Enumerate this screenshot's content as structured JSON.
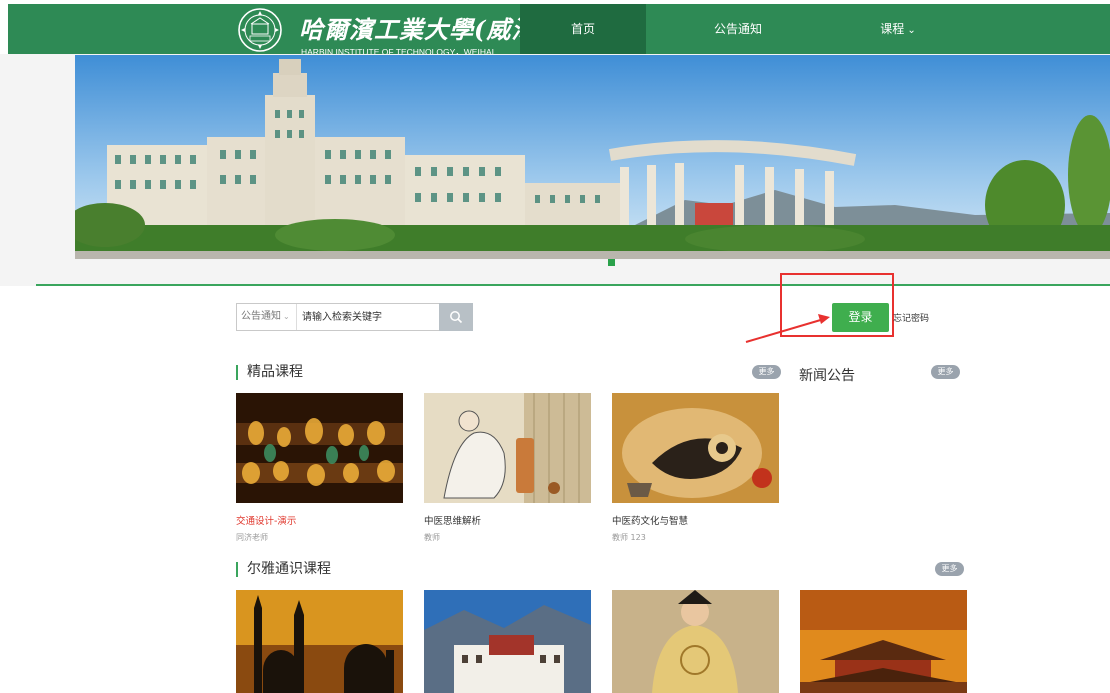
{
  "header": {
    "logo_cn": "哈爾濱工業大學(威海)",
    "logo_en": "HARBIN  INSTITUTE OF TECHNOLOGY，WEIHAI",
    "nav": [
      {
        "label": "首页",
        "active": true
      },
      {
        "label": "公告通知",
        "active": false
      },
      {
        "label": "课程",
        "active": false,
        "has_dropdown": true
      }
    ]
  },
  "banner": {
    "slide_count": 1,
    "active_slide": 1
  },
  "search": {
    "category": "公告通知",
    "placeholder": "请输入检索关键字",
    "search_icon": "search-icon"
  },
  "login": {
    "login_label": "登录",
    "forgot_label": "忘记密码"
  },
  "featured": {
    "title": "精品课程",
    "more_label": "更多",
    "courses": [
      {
        "name": "交通设计-演示",
        "teacher": "同济老师",
        "highlight": true
      },
      {
        "name": "中医思维解析",
        "teacher": "教师",
        "highlight": false
      },
      {
        "name": "中医药文化与智慧",
        "teacher": "教师 123",
        "highlight": false
      }
    ]
  },
  "news": {
    "title": "新闻公告",
    "more_label": "更多"
  },
  "erya": {
    "title": "尔雅通识课程",
    "more_label": "更多"
  },
  "colors": {
    "header_green": "#2e8a55",
    "active_nav": "#1f6b40",
    "login_green": "#3fae4e",
    "annotation_red": "#e8312f",
    "course_highlight": "#e0382e"
  }
}
